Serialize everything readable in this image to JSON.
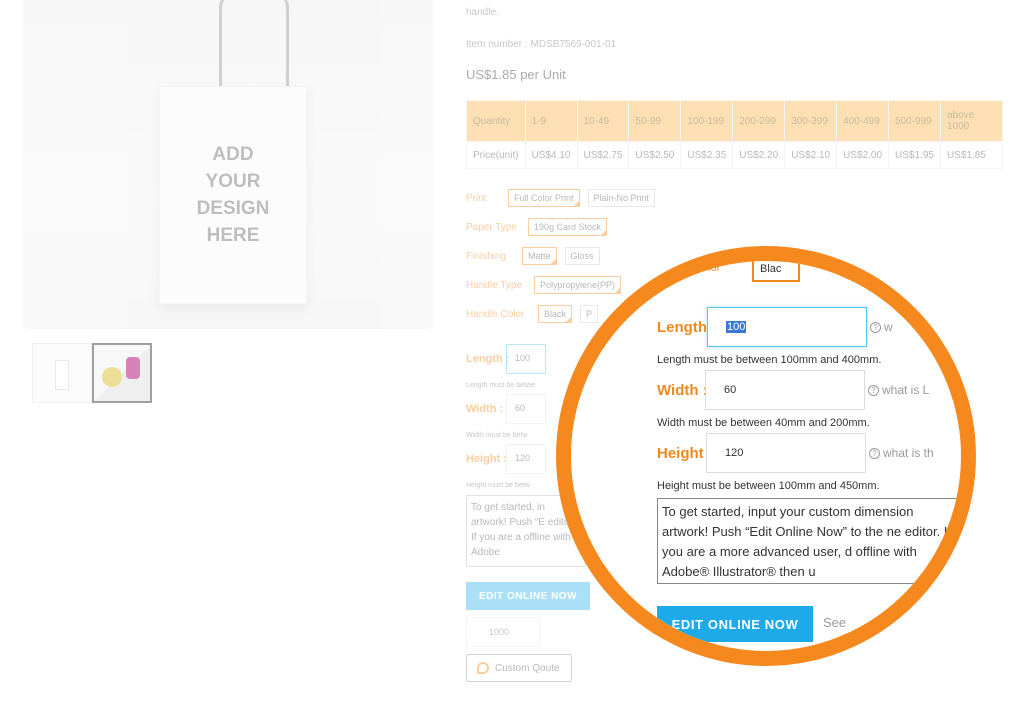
{
  "product": {
    "placeholder_lines": [
      "ADD",
      "YOUR",
      "DESIGN",
      "HERE"
    ],
    "description_tail": "handle.",
    "item_number": "Item number : MDSB7569-001-01",
    "price": "US$1.85 per Unit"
  },
  "price_table": {
    "header": [
      "Quantity",
      "1-9",
      "10-49",
      "50-99",
      "100-199",
      "200-299",
      "300-399",
      "400-499",
      "500-999",
      "above 1000"
    ],
    "row": [
      "Price(unit)",
      "US$4.10",
      "US$2.75",
      "US$2.50",
      "US$2.35",
      "US$2.20",
      "US$2.10",
      "US$2.00",
      "US$1.95",
      "US$1.85"
    ]
  },
  "options": {
    "print": {
      "label": "Print",
      "choices": [
        "Full Color Print",
        "Plain-No Print"
      ]
    },
    "paper": {
      "label": "Paper Type",
      "choices": [
        "190g Card Stock"
      ]
    },
    "finishing": {
      "label": "Finishing",
      "choices": [
        "Matte",
        "Gloss"
      ]
    },
    "handle_type": {
      "label": "Handle Type",
      "choices": [
        "Polypropylene(PP)"
      ]
    },
    "handle_color": {
      "label": "Handle Color",
      "choices": [
        "Black",
        "P"
      ]
    }
  },
  "dimensions": {
    "length": {
      "label": "Length :",
      "value": "100",
      "hint": "Length must be between 100mm and 400mm.",
      "help": "w"
    },
    "width": {
      "label": "Width :",
      "value": "60",
      "hint": "Width must be between 40mm and 200mm.",
      "help": "what is L"
    },
    "height": {
      "label": "Height :",
      "value": "120",
      "hint": "Height must be between 100mm and 450mm.",
      "help": "what is th"
    },
    "mini_hints": {
      "length": "Length must be betwe",
      "width": "Width must be betw",
      "height": "Height must be betw"
    },
    "instructions": "To get started, input your custom dimension artwork! Push “Edit Online Now” to the ne editor. If you are a more advanced user, d offline with Adobe® Illustrator® then u",
    "mini_instructions": "To get started, in artwork! Push “E editor. If you are a offline with Adobe"
  },
  "actions": {
    "edit_online": "EDIT ONLINE NOW",
    "see": "See",
    "quantity": "1000",
    "custom_quote": "Custom Qoute"
  },
  "zoom": {
    "top_label": "olor",
    "top_chip": "Blac"
  },
  "colors": {
    "accent": "#f5891d",
    "button": "#1ea9e9",
    "table_head": "#f7b64a"
  }
}
